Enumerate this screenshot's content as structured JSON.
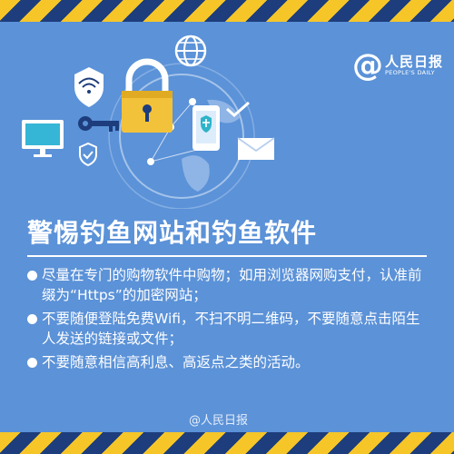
{
  "brand": {
    "name": "人民日报",
    "subtitle": "PEOPLE'S DAILY"
  },
  "title": "警惕钓鱼网站和钓鱼软件",
  "bullets": [
    "尽量在专门的购物软件中购物；如用浏览器网购支付，认准前缀为“Https”的加密网站；",
    "不要随便登陆免费Wifi，不扫不明二维码，不要随意点击陌生人发送的链接或文件；",
    "不要随意相信高利息、高返点之类的活动。"
  ],
  "watermark": "@人民日报",
  "icons": [
    "globe-icon",
    "wifi-shield-icon",
    "key-icon",
    "padlock-icon",
    "smartphone-icon",
    "checkmark-icon",
    "envelope-icon",
    "monitor-icon",
    "shield-check-icon"
  ],
  "colors": {
    "background": "#5b92d8",
    "stripe_yellow": "#f6c629",
    "stripe_navy": "#1d3d7c",
    "lock_body": "#f2c23a",
    "text": "#ffffff"
  }
}
